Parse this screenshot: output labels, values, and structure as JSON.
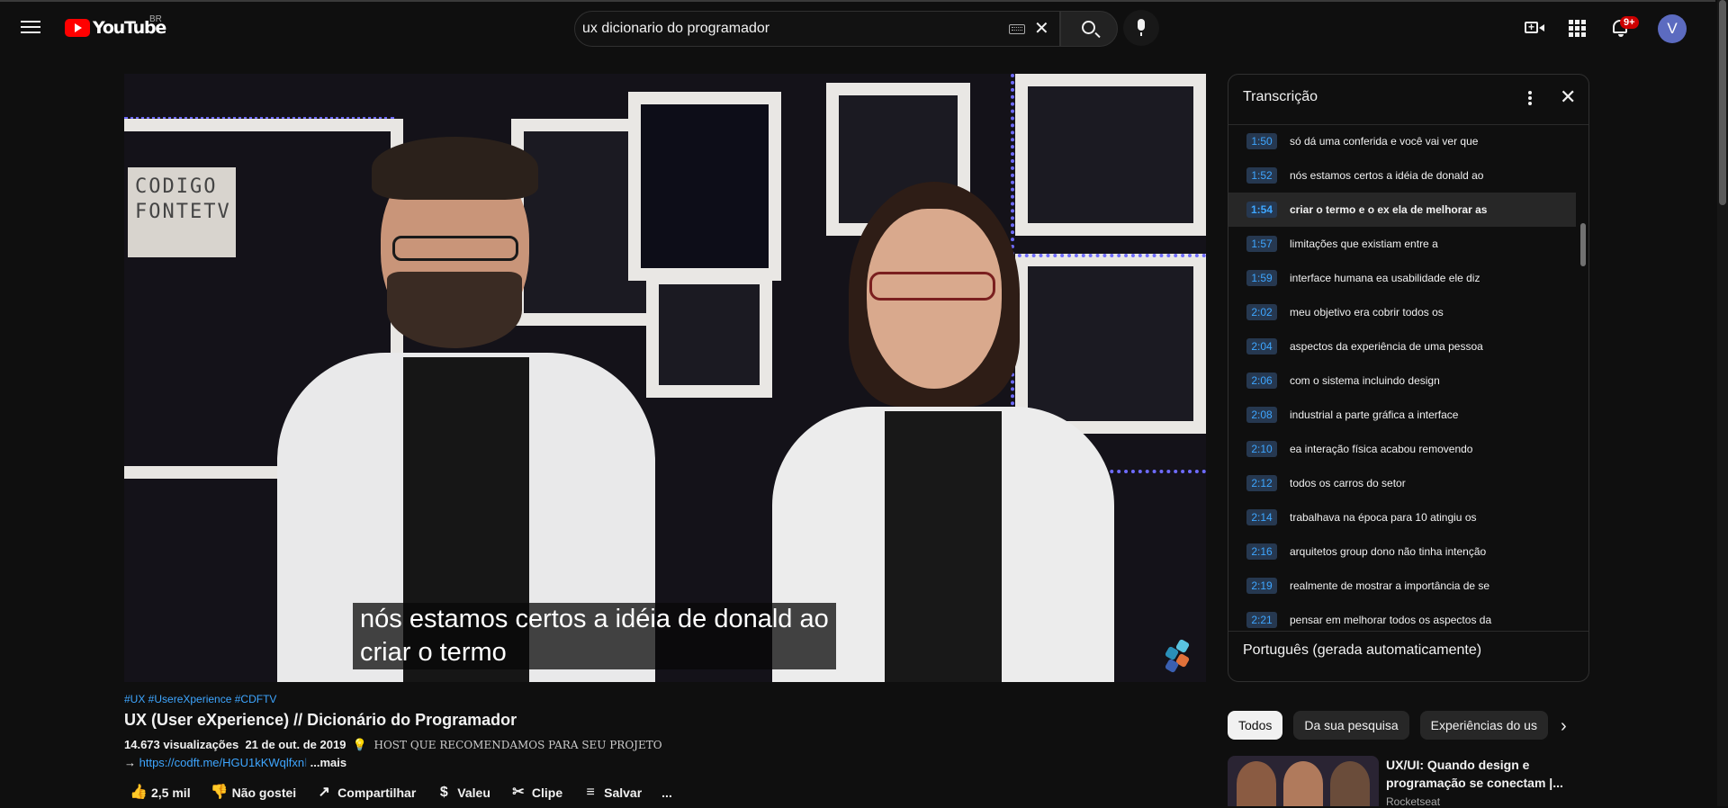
{
  "header": {
    "logo_text": "YouTube",
    "country": "BR",
    "search_value": "ux dicionario do programador",
    "notification_count": "9+",
    "avatar_letter": "V"
  },
  "video": {
    "caption_line1": "nós estamos certos a idéia de donald ao",
    "caption_line2": "criar o termo",
    "shelf_sign": "CODIGO FONTETV"
  },
  "info": {
    "hashtags": "#UX #UsereXperience #CDFTV",
    "title": "UX (User eXperience) // Dicionário do Programador",
    "views": "14.673 visualizações",
    "date": "21 de out. de 2019",
    "desc_bulb": "💡",
    "desc_text": "HOST QUE RECOMENDAMOS PARA SEU PROJETO",
    "desc_arrow": "→",
    "desc_link": "https://codft.me/HGU1kKWqlfxn",
    "desc_link_fade": "l",
    "more": "...mais"
  },
  "actions": {
    "like_count": "2,5 mil",
    "dislike": "Não gostei",
    "share": "Compartilhar",
    "thanks": "Valeu",
    "clip": "Clipe",
    "save": "Salvar",
    "more": "..."
  },
  "transcript": {
    "title": "Transcrição",
    "language": "Português (gerada automaticamente)",
    "segments": [
      {
        "time": "1:50",
        "text": "só dá uma conferida e você vai ver que"
      },
      {
        "time": "1:52",
        "text": "nós estamos certos a idéia de donald ao"
      },
      {
        "time": "1:54",
        "text": "criar o termo e o ex ela de melhorar as"
      },
      {
        "time": "1:57",
        "text": "limitações que existiam entre a"
      },
      {
        "time": "1:59",
        "text": "interface humana ea usabilidade ele diz"
      },
      {
        "time": "2:02",
        "text": "meu objetivo era cobrir todos os"
      },
      {
        "time": "2:04",
        "text": "aspectos da experiência de uma pessoa"
      },
      {
        "time": "2:06",
        "text": "com o sistema incluindo design"
      },
      {
        "time": "2:08",
        "text": "industrial a parte gráfica a interface"
      },
      {
        "time": "2:10",
        "text": "ea interação física acabou removendo"
      },
      {
        "time": "2:12",
        "text": "todos os carros do setor"
      },
      {
        "time": "2:14",
        "text": "trabalhava na época para 10 atingiu os"
      },
      {
        "time": "2:16",
        "text": "arquitetos group dono não tinha intenção"
      },
      {
        "time": "2:19",
        "text": "realmente de mostrar a importância de se"
      },
      {
        "time": "2:21",
        "text": "pensar em melhorar todos os aspectos da"
      }
    ],
    "active_index": 2
  },
  "chips": [
    "Todos",
    "Da sua pesquisa",
    "Experiências do us"
  ],
  "recommendation": {
    "title": "UX/UI: Quando design e programação se conectam |...",
    "channel": "Rocketseat"
  },
  "colors": {
    "accent_blue": "#3ea6ff",
    "brand_red": "#ff0000",
    "background": "#0f0f0f"
  }
}
